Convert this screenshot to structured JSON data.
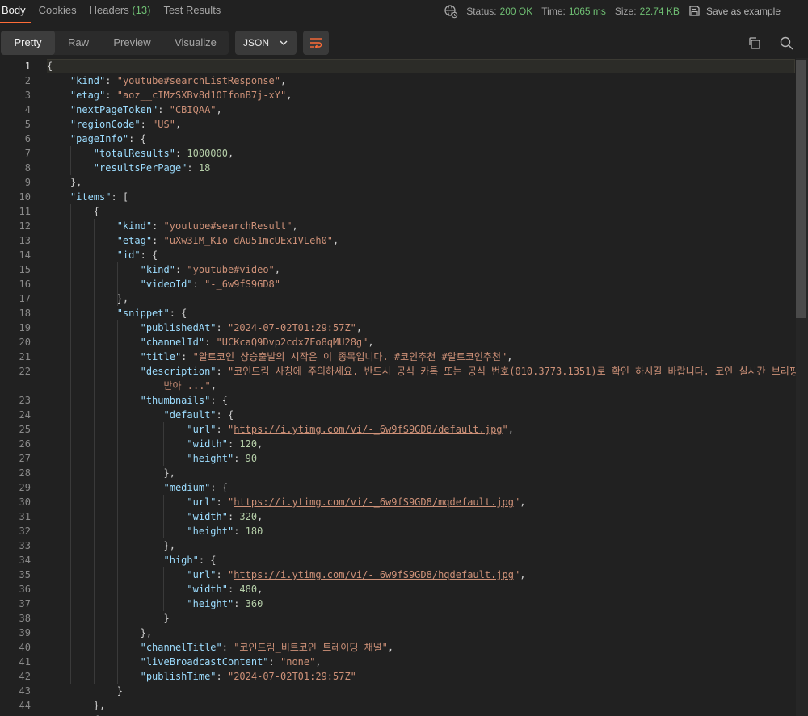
{
  "tabs": [
    {
      "label": "Body",
      "active": true
    },
    {
      "label": "Cookies"
    },
    {
      "label": "Headers",
      "count": "(13)"
    },
    {
      "label": "Test Results"
    }
  ],
  "status": {
    "status_label": "Status:",
    "status_value": "200 OK",
    "time_label": "Time:",
    "time_value": "1065 ms",
    "size_label": "Size:",
    "size_value": "22.74 KB",
    "save_label": "Save as example"
  },
  "view_modes": [
    "Pretty",
    "Raw",
    "Preview",
    "Visualize"
  ],
  "active_view": "Pretty",
  "format": "JSON",
  "icons": [
    "globe-icon",
    "save-icon",
    "chevron-down-icon",
    "wrap-lines-icon",
    "copy-icon",
    "search-icon"
  ],
  "colors": {
    "accent": "#ff6c37",
    "status_ok": "#6fbf73",
    "key": "#9cdcfe",
    "string": "#ce9178",
    "number": "#b5cea8"
  },
  "line_numbers": [
    "1",
    "2",
    "3",
    "4",
    "5",
    "6",
    "7",
    "8",
    "9",
    "10",
    "11",
    "12",
    "13",
    "14",
    "15",
    "16",
    "17",
    "18",
    "19",
    "20",
    "21",
    "22",
    "23",
    "24",
    "25",
    "26",
    "27",
    "28",
    "29",
    "30",
    "31",
    "32",
    "33",
    "34",
    "35",
    "36",
    "37",
    "38",
    "39",
    "40",
    "41",
    "42",
    "43",
    "44"
  ],
  "code_lines": [
    [
      [
        "p",
        "{"
      ]
    ],
    [
      [
        "p",
        "    "
      ],
      [
        "k",
        "\"kind\""
      ],
      [
        "p",
        ": "
      ],
      [
        "s",
        "\"youtube#searchListResponse\""
      ],
      [
        "p",
        ","
      ]
    ],
    [
      [
        "p",
        "    "
      ],
      [
        "k",
        "\"etag\""
      ],
      [
        "p",
        ": "
      ],
      [
        "s",
        "\"aoz__cIMzSXBv8d1OIfonB7j-xY\""
      ],
      [
        "p",
        ","
      ]
    ],
    [
      [
        "p",
        "    "
      ],
      [
        "k",
        "\"nextPageToken\""
      ],
      [
        "p",
        ": "
      ],
      [
        "s",
        "\"CBIQAA\""
      ],
      [
        "p",
        ","
      ]
    ],
    [
      [
        "p",
        "    "
      ],
      [
        "k",
        "\"regionCode\""
      ],
      [
        "p",
        ": "
      ],
      [
        "s",
        "\"US\""
      ],
      [
        "p",
        ","
      ]
    ],
    [
      [
        "p",
        "    "
      ],
      [
        "k",
        "\"pageInfo\""
      ],
      [
        "p",
        ": {"
      ]
    ],
    [
      [
        "p",
        "        "
      ],
      [
        "k",
        "\"totalResults\""
      ],
      [
        "p",
        ": "
      ],
      [
        "n",
        "1000000"
      ],
      [
        "p",
        ","
      ]
    ],
    [
      [
        "p",
        "        "
      ],
      [
        "k",
        "\"resultsPerPage\""
      ],
      [
        "p",
        ": "
      ],
      [
        "n",
        "18"
      ]
    ],
    [
      [
        "p",
        "    },"
      ]
    ],
    [
      [
        "p",
        "    "
      ],
      [
        "k",
        "\"items\""
      ],
      [
        "p",
        ": ["
      ]
    ],
    [
      [
        "p",
        "        {"
      ]
    ],
    [
      [
        "p",
        "            "
      ],
      [
        "k",
        "\"kind\""
      ],
      [
        "p",
        ": "
      ],
      [
        "s",
        "\"youtube#searchResult\""
      ],
      [
        "p",
        ","
      ]
    ],
    [
      [
        "p",
        "            "
      ],
      [
        "k",
        "\"etag\""
      ],
      [
        "p",
        ": "
      ],
      [
        "s",
        "\"uXw3IM_KIo-dAu51mcUEx1VLeh0\""
      ],
      [
        "p",
        ","
      ]
    ],
    [
      [
        "p",
        "            "
      ],
      [
        "k",
        "\"id\""
      ],
      [
        "p",
        ": {"
      ]
    ],
    [
      [
        "p",
        "                "
      ],
      [
        "k",
        "\"kind\""
      ],
      [
        "p",
        ": "
      ],
      [
        "s",
        "\"youtube#video\""
      ],
      [
        "p",
        ","
      ]
    ],
    [
      [
        "p",
        "                "
      ],
      [
        "k",
        "\"videoId\""
      ],
      [
        "p",
        ": "
      ],
      [
        "s",
        "\"-_6w9fS9GD8\""
      ]
    ],
    [
      [
        "p",
        "            },"
      ]
    ],
    [
      [
        "p",
        "            "
      ],
      [
        "k",
        "\"snippet\""
      ],
      [
        "p",
        ": {"
      ]
    ],
    [
      [
        "p",
        "                "
      ],
      [
        "k",
        "\"publishedAt\""
      ],
      [
        "p",
        ": "
      ],
      [
        "s",
        "\"2024-07-02T01:29:57Z\""
      ],
      [
        "p",
        ","
      ]
    ],
    [
      [
        "p",
        "                "
      ],
      [
        "k",
        "\"channelId\""
      ],
      [
        "p",
        ": "
      ],
      [
        "s",
        "\"UCKcaQ9Dvp2cdx7Fo8qMU28g\""
      ],
      [
        "p",
        ","
      ]
    ],
    [
      [
        "p",
        "                "
      ],
      [
        "k",
        "\"title\""
      ],
      [
        "p",
        ": "
      ],
      [
        "s",
        "\"알트코인 상승출발의 시작은 이 종목입니다. #코인추천 #알트코인추천\""
      ],
      [
        "p",
        ","
      ]
    ],
    [
      [
        "p",
        "                "
      ],
      [
        "k",
        "\"description\""
      ],
      [
        "p",
        ": "
      ],
      [
        "s",
        "\"코인드림 사칭에 주의하세요. 반드시 공식 카톡 또는 공식 번호(010.3773.1351)로 확인 하시길 바랍니다. 코인 실시간 브리핑"
      ]
    ],
    [
      [
        "p",
        "                    "
      ],
      [
        "s",
        "받아 ...\""
      ],
      [
        "p",
        ","
      ]
    ],
    [
      [
        "p",
        "                "
      ],
      [
        "k",
        "\"thumbnails\""
      ],
      [
        "p",
        ": {"
      ]
    ],
    [
      [
        "p",
        "                    "
      ],
      [
        "k",
        "\"default\""
      ],
      [
        "p",
        ": {"
      ]
    ],
    [
      [
        "p",
        "                        "
      ],
      [
        "k",
        "\"url\""
      ],
      [
        "p",
        ": "
      ],
      [
        "s",
        "\""
      ],
      [
        "u",
        "https://i.ytimg.com/vi/-_6w9fS9GD8/default.jpg"
      ],
      [
        "s",
        "\""
      ],
      [
        "p",
        ","
      ]
    ],
    [
      [
        "p",
        "                        "
      ],
      [
        "k",
        "\"width\""
      ],
      [
        "p",
        ": "
      ],
      [
        "n",
        "120"
      ],
      [
        "p",
        ","
      ]
    ],
    [
      [
        "p",
        "                        "
      ],
      [
        "k",
        "\"height\""
      ],
      [
        "p",
        ": "
      ],
      [
        "n",
        "90"
      ]
    ],
    [
      [
        "p",
        "                    },"
      ]
    ],
    [
      [
        "p",
        "                    "
      ],
      [
        "k",
        "\"medium\""
      ],
      [
        "p",
        ": {"
      ]
    ],
    [
      [
        "p",
        "                        "
      ],
      [
        "k",
        "\"url\""
      ],
      [
        "p",
        ": "
      ],
      [
        "s",
        "\""
      ],
      [
        "u",
        "https://i.ytimg.com/vi/-_6w9fS9GD8/mqdefault.jpg"
      ],
      [
        "s",
        "\""
      ],
      [
        "p",
        ","
      ]
    ],
    [
      [
        "p",
        "                        "
      ],
      [
        "k",
        "\"width\""
      ],
      [
        "p",
        ": "
      ],
      [
        "n",
        "320"
      ],
      [
        "p",
        ","
      ]
    ],
    [
      [
        "p",
        "                        "
      ],
      [
        "k",
        "\"height\""
      ],
      [
        "p",
        ": "
      ],
      [
        "n",
        "180"
      ]
    ],
    [
      [
        "p",
        "                    },"
      ]
    ],
    [
      [
        "p",
        "                    "
      ],
      [
        "k",
        "\"high\""
      ],
      [
        "p",
        ": {"
      ]
    ],
    [
      [
        "p",
        "                        "
      ],
      [
        "k",
        "\"url\""
      ],
      [
        "p",
        ": "
      ],
      [
        "s",
        "\""
      ],
      [
        "u",
        "https://i.ytimg.com/vi/-_6w9fS9GD8/hqdefault.jpg"
      ],
      [
        "s",
        "\""
      ],
      [
        "p",
        ","
      ]
    ],
    [
      [
        "p",
        "                        "
      ],
      [
        "k",
        "\"width\""
      ],
      [
        "p",
        ": "
      ],
      [
        "n",
        "480"
      ],
      [
        "p",
        ","
      ]
    ],
    [
      [
        "p",
        "                        "
      ],
      [
        "k",
        "\"height\""
      ],
      [
        "p",
        ": "
      ],
      [
        "n",
        "360"
      ]
    ],
    [
      [
        "p",
        "                    }"
      ]
    ],
    [
      [
        "p",
        "                },"
      ]
    ],
    [
      [
        "p",
        "                "
      ],
      [
        "k",
        "\"channelTitle\""
      ],
      [
        "p",
        ": "
      ],
      [
        "s",
        "\"코인드림_비트코인 트레이딩 채널\""
      ],
      [
        "p",
        ","
      ]
    ],
    [
      [
        "p",
        "                "
      ],
      [
        "k",
        "\"liveBroadcastContent\""
      ],
      [
        "p",
        ": "
      ],
      [
        "s",
        "\"none\""
      ],
      [
        "p",
        ","
      ]
    ],
    [
      [
        "p",
        "                "
      ],
      [
        "k",
        "\"publishTime\""
      ],
      [
        "p",
        ": "
      ],
      [
        "s",
        "\"2024-07-02T01:29:57Z\""
      ]
    ],
    [
      [
        "p",
        "            }"
      ]
    ],
    [
      [
        "p",
        "        },"
      ]
    ],
    [
      [
        "p",
        "        {"
      ]
    ]
  ]
}
